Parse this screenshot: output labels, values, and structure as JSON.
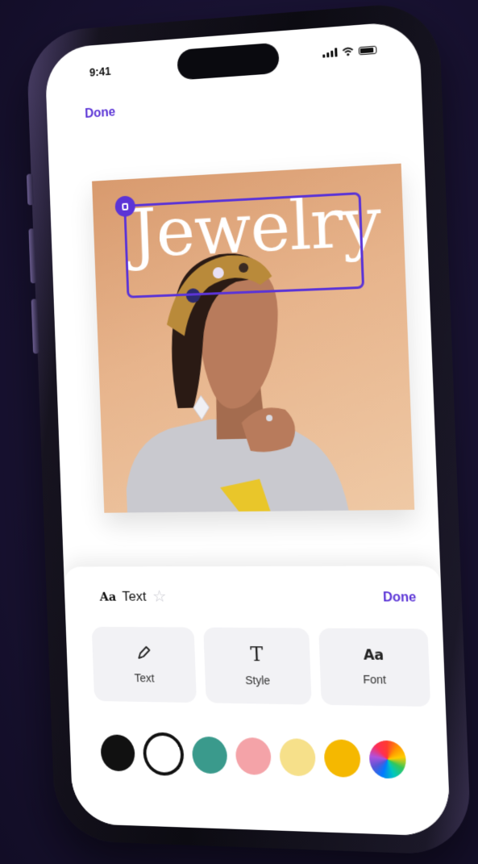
{
  "status_bar": {
    "time": "9:41"
  },
  "nav": {
    "done_label": "Done"
  },
  "canvas": {
    "text_layer": "Jewelry",
    "background_color": "#e7b48c",
    "accent_color": "#5b34d6"
  },
  "panel": {
    "title_icon": "Aa",
    "title": "Text",
    "favorite_icon": "star-icon",
    "done_label": "Done",
    "tools": [
      {
        "icon": "pencil-icon",
        "label": "Text"
      },
      {
        "icon": "T",
        "label": "Style"
      },
      {
        "icon": "Aa",
        "label": "Font"
      }
    ],
    "colors": [
      "#111111",
      "#ffffff",
      "#3a9a8c",
      "#f4a3a8",
      "#f6e08a",
      "#f5b800",
      "color-wheel"
    ],
    "selected_color_index": 1
  }
}
